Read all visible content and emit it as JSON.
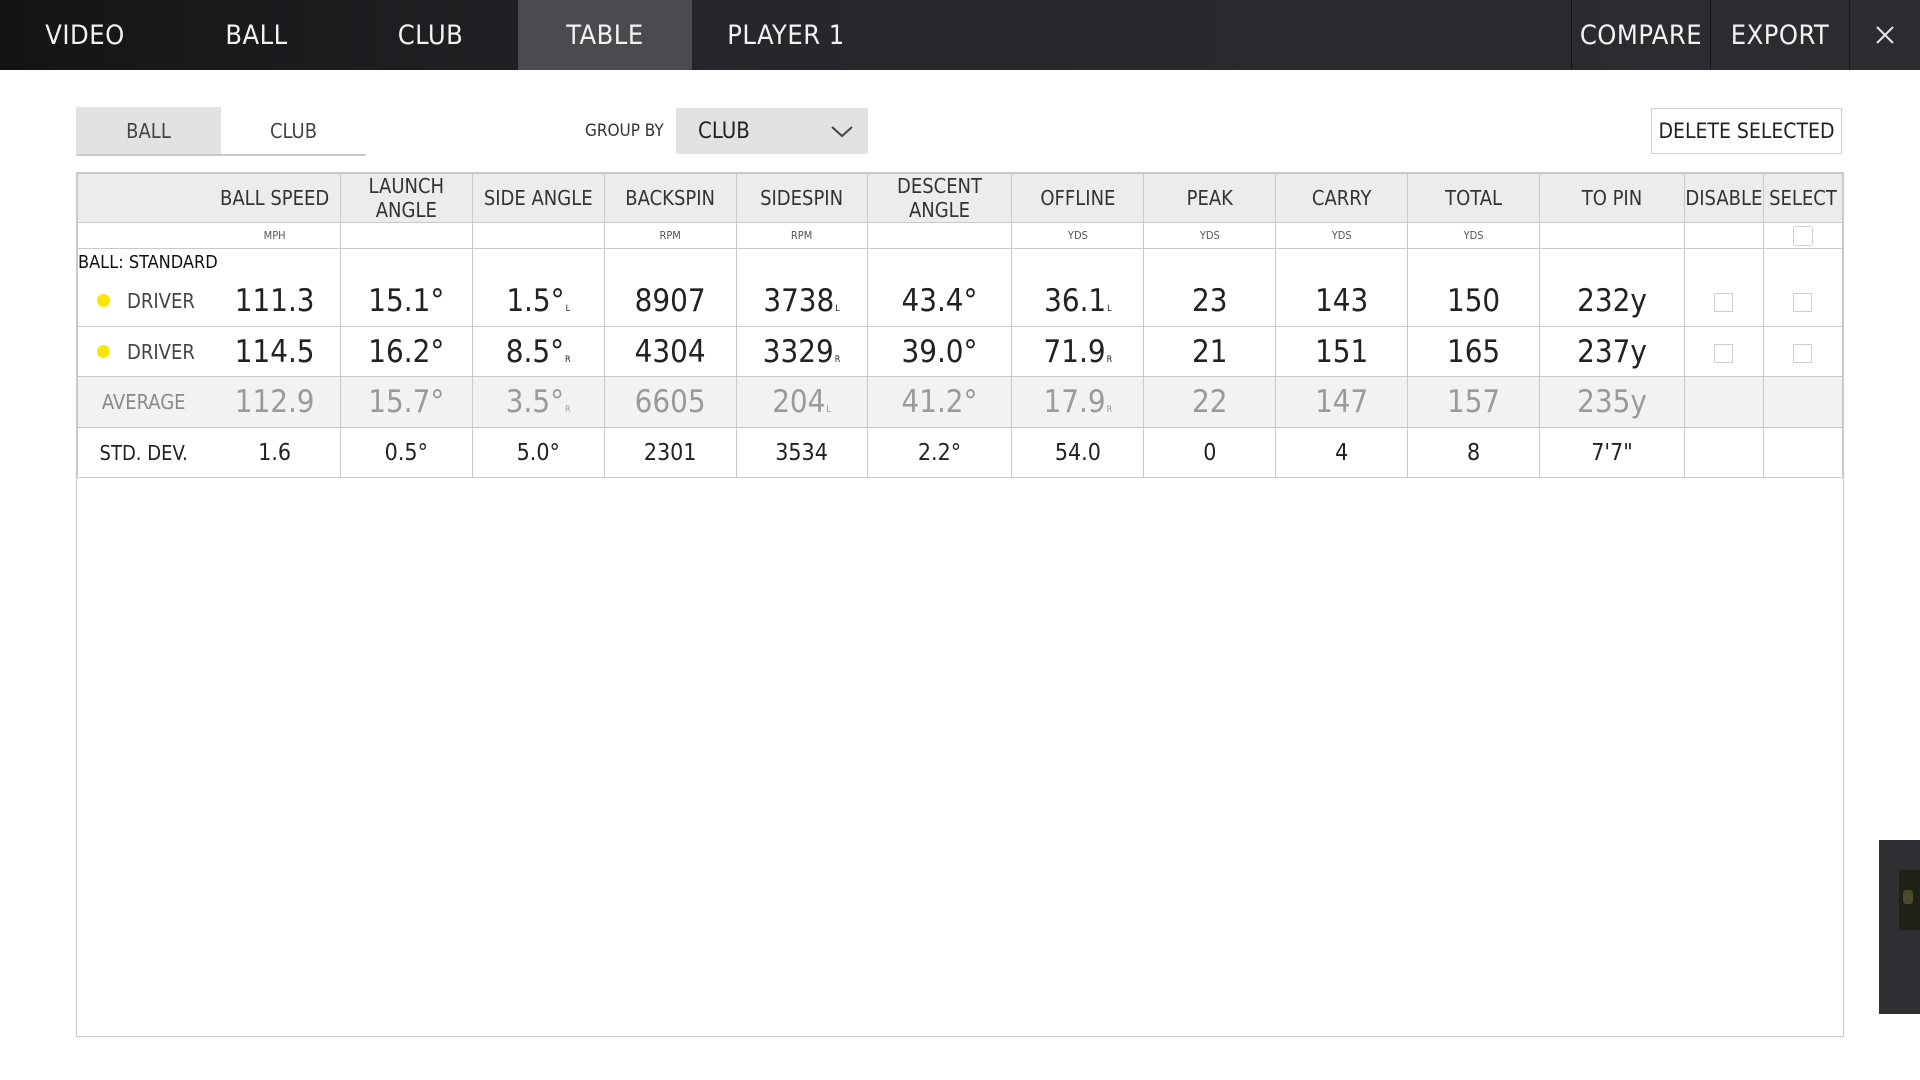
{
  "nav": {
    "tabs": [
      {
        "label": "VIDEO"
      },
      {
        "label": "BALL"
      },
      {
        "label": "CLUB"
      },
      {
        "label": "TABLE"
      },
      {
        "label": "PLAYER 1"
      }
    ],
    "active_tab": "TABLE",
    "compare_label": "COMPARE",
    "export_label": "EXPORT",
    "close_icon": "close-icon"
  },
  "filter": {
    "segments": [
      {
        "label": "BALL"
      },
      {
        "label": "CLUB"
      }
    ],
    "active_segment": "BALL",
    "group_by_label": "GROUP BY",
    "group_by_value": "CLUB",
    "delete_label": "DELETE SELECTED"
  },
  "table": {
    "columns": [
      {
        "label": "BALL SPEED",
        "unit": "MPH"
      },
      {
        "label": "LAUNCH ANGLE",
        "unit": ""
      },
      {
        "label": "SIDE ANGLE",
        "unit": ""
      },
      {
        "label": "BACKSPIN",
        "unit": "RPM"
      },
      {
        "label": "SIDESPIN",
        "unit": "RPM"
      },
      {
        "label": "DESCENT ANGLE",
        "unit": ""
      },
      {
        "label": "OFFLINE",
        "unit": "YDS"
      },
      {
        "label": "PEAK",
        "unit": "YDS"
      },
      {
        "label": "CARRY",
        "unit": "YDS"
      },
      {
        "label": "TOTAL",
        "unit": "YDS"
      },
      {
        "label": "TO PIN",
        "unit": ""
      },
      {
        "label": "DISABLE",
        "unit": ""
      },
      {
        "label": "SELECT",
        "unit": ""
      }
    ],
    "group_label": "BALL: STANDARD",
    "rows": [
      {
        "label": "DRIVER",
        "dot_color": "#ffe600",
        "ball_speed": "111.3",
        "launch_angle": "15.1°",
        "side_angle": "1.5°",
        "side_angle_dir": "L",
        "backspin": "8907",
        "sidespin": "3738",
        "sidespin_dir": "L",
        "descent_angle": "43.4°",
        "offline": "36.1",
        "offline_dir": "L",
        "peak": "23",
        "carry": "143",
        "total": "150",
        "to_pin": "232y"
      },
      {
        "label": "DRIVER",
        "dot_color": "#ffe600",
        "ball_speed": "114.5",
        "launch_angle": "16.2°",
        "side_angle": "8.5°",
        "side_angle_dir": "R",
        "backspin": "4304",
        "sidespin": "3329",
        "sidespin_dir": "R",
        "descent_angle": "39.0°",
        "offline": "71.9",
        "offline_dir": "R",
        "peak": "21",
        "carry": "151",
        "total": "165",
        "to_pin": "237y"
      }
    ],
    "average": {
      "label": "AVERAGE",
      "ball_speed": "112.9",
      "launch_angle": "15.7°",
      "side_angle": "3.5°",
      "side_angle_dir": "R",
      "backspin": "6605",
      "sidespin": "204",
      "sidespin_dir": "L",
      "descent_angle": "41.2°",
      "offline": "17.9",
      "offline_dir": "R",
      "peak": "22",
      "carry": "147",
      "total": "157",
      "to_pin": "235y"
    },
    "std_dev": {
      "label": "STD. DEV.",
      "ball_speed": "1.6",
      "launch_angle": "0.5°",
      "side_angle": "5.0°",
      "backspin": "2301",
      "sidespin": "3534",
      "descent_angle": "2.2°",
      "offline": "54.0",
      "peak": "0",
      "carry": "4",
      "total": "8",
      "to_pin": "7'7\""
    }
  }
}
